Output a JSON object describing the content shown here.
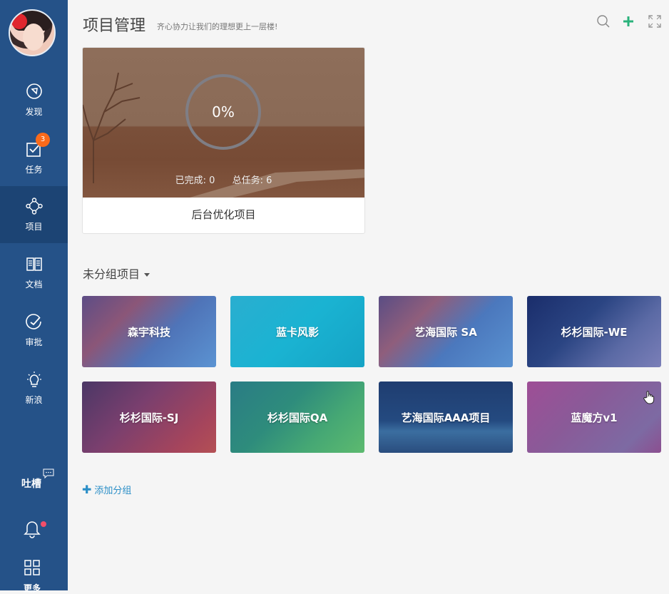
{
  "sidebar": {
    "items": [
      {
        "label": "发现",
        "icon": "compass-icon"
      },
      {
        "label": "任务",
        "icon": "checkbox-icon",
        "badge": "3"
      },
      {
        "label": "项目",
        "icon": "project-nodes-icon",
        "active": true
      },
      {
        "label": "文档",
        "icon": "book-icon"
      },
      {
        "label": "审批",
        "icon": "approval-icon"
      },
      {
        "label": "新浪",
        "icon": "lightbulb-icon"
      }
    ],
    "tucao_label": "吐槽",
    "more_label": "更多"
  },
  "header": {
    "title": "项目管理",
    "subtitle": "齐心协力让我们的理想更上一层楼!",
    "icons": [
      "search-icon",
      "plus-icon",
      "fullscreen-icon"
    ]
  },
  "featured": {
    "progress": "0%",
    "progress_value": 0,
    "completed_label": "已完成: 0",
    "total_label": "总任务: 6",
    "name": "后台优化项目"
  },
  "group": {
    "title": "未分组项目",
    "projects": [
      {
        "name": "森宇科技"
      },
      {
        "name": "蓝卡风影"
      },
      {
        "name": "艺海国际 SA"
      },
      {
        "name": "杉杉国际-WE"
      },
      {
        "name": "杉杉国际-SJ"
      },
      {
        "name": "杉杉国际QA"
      },
      {
        "name": "艺海国际AAA项目"
      },
      {
        "name": "蓝魔方v1"
      }
    ],
    "add_label": "添加分组"
  },
  "colors": {
    "sidebar": "#255288",
    "sidebar_active": "#1c4474",
    "badge": "#f96a1b",
    "accent_green": "#2ab27b",
    "link": "#2a8ec7"
  }
}
